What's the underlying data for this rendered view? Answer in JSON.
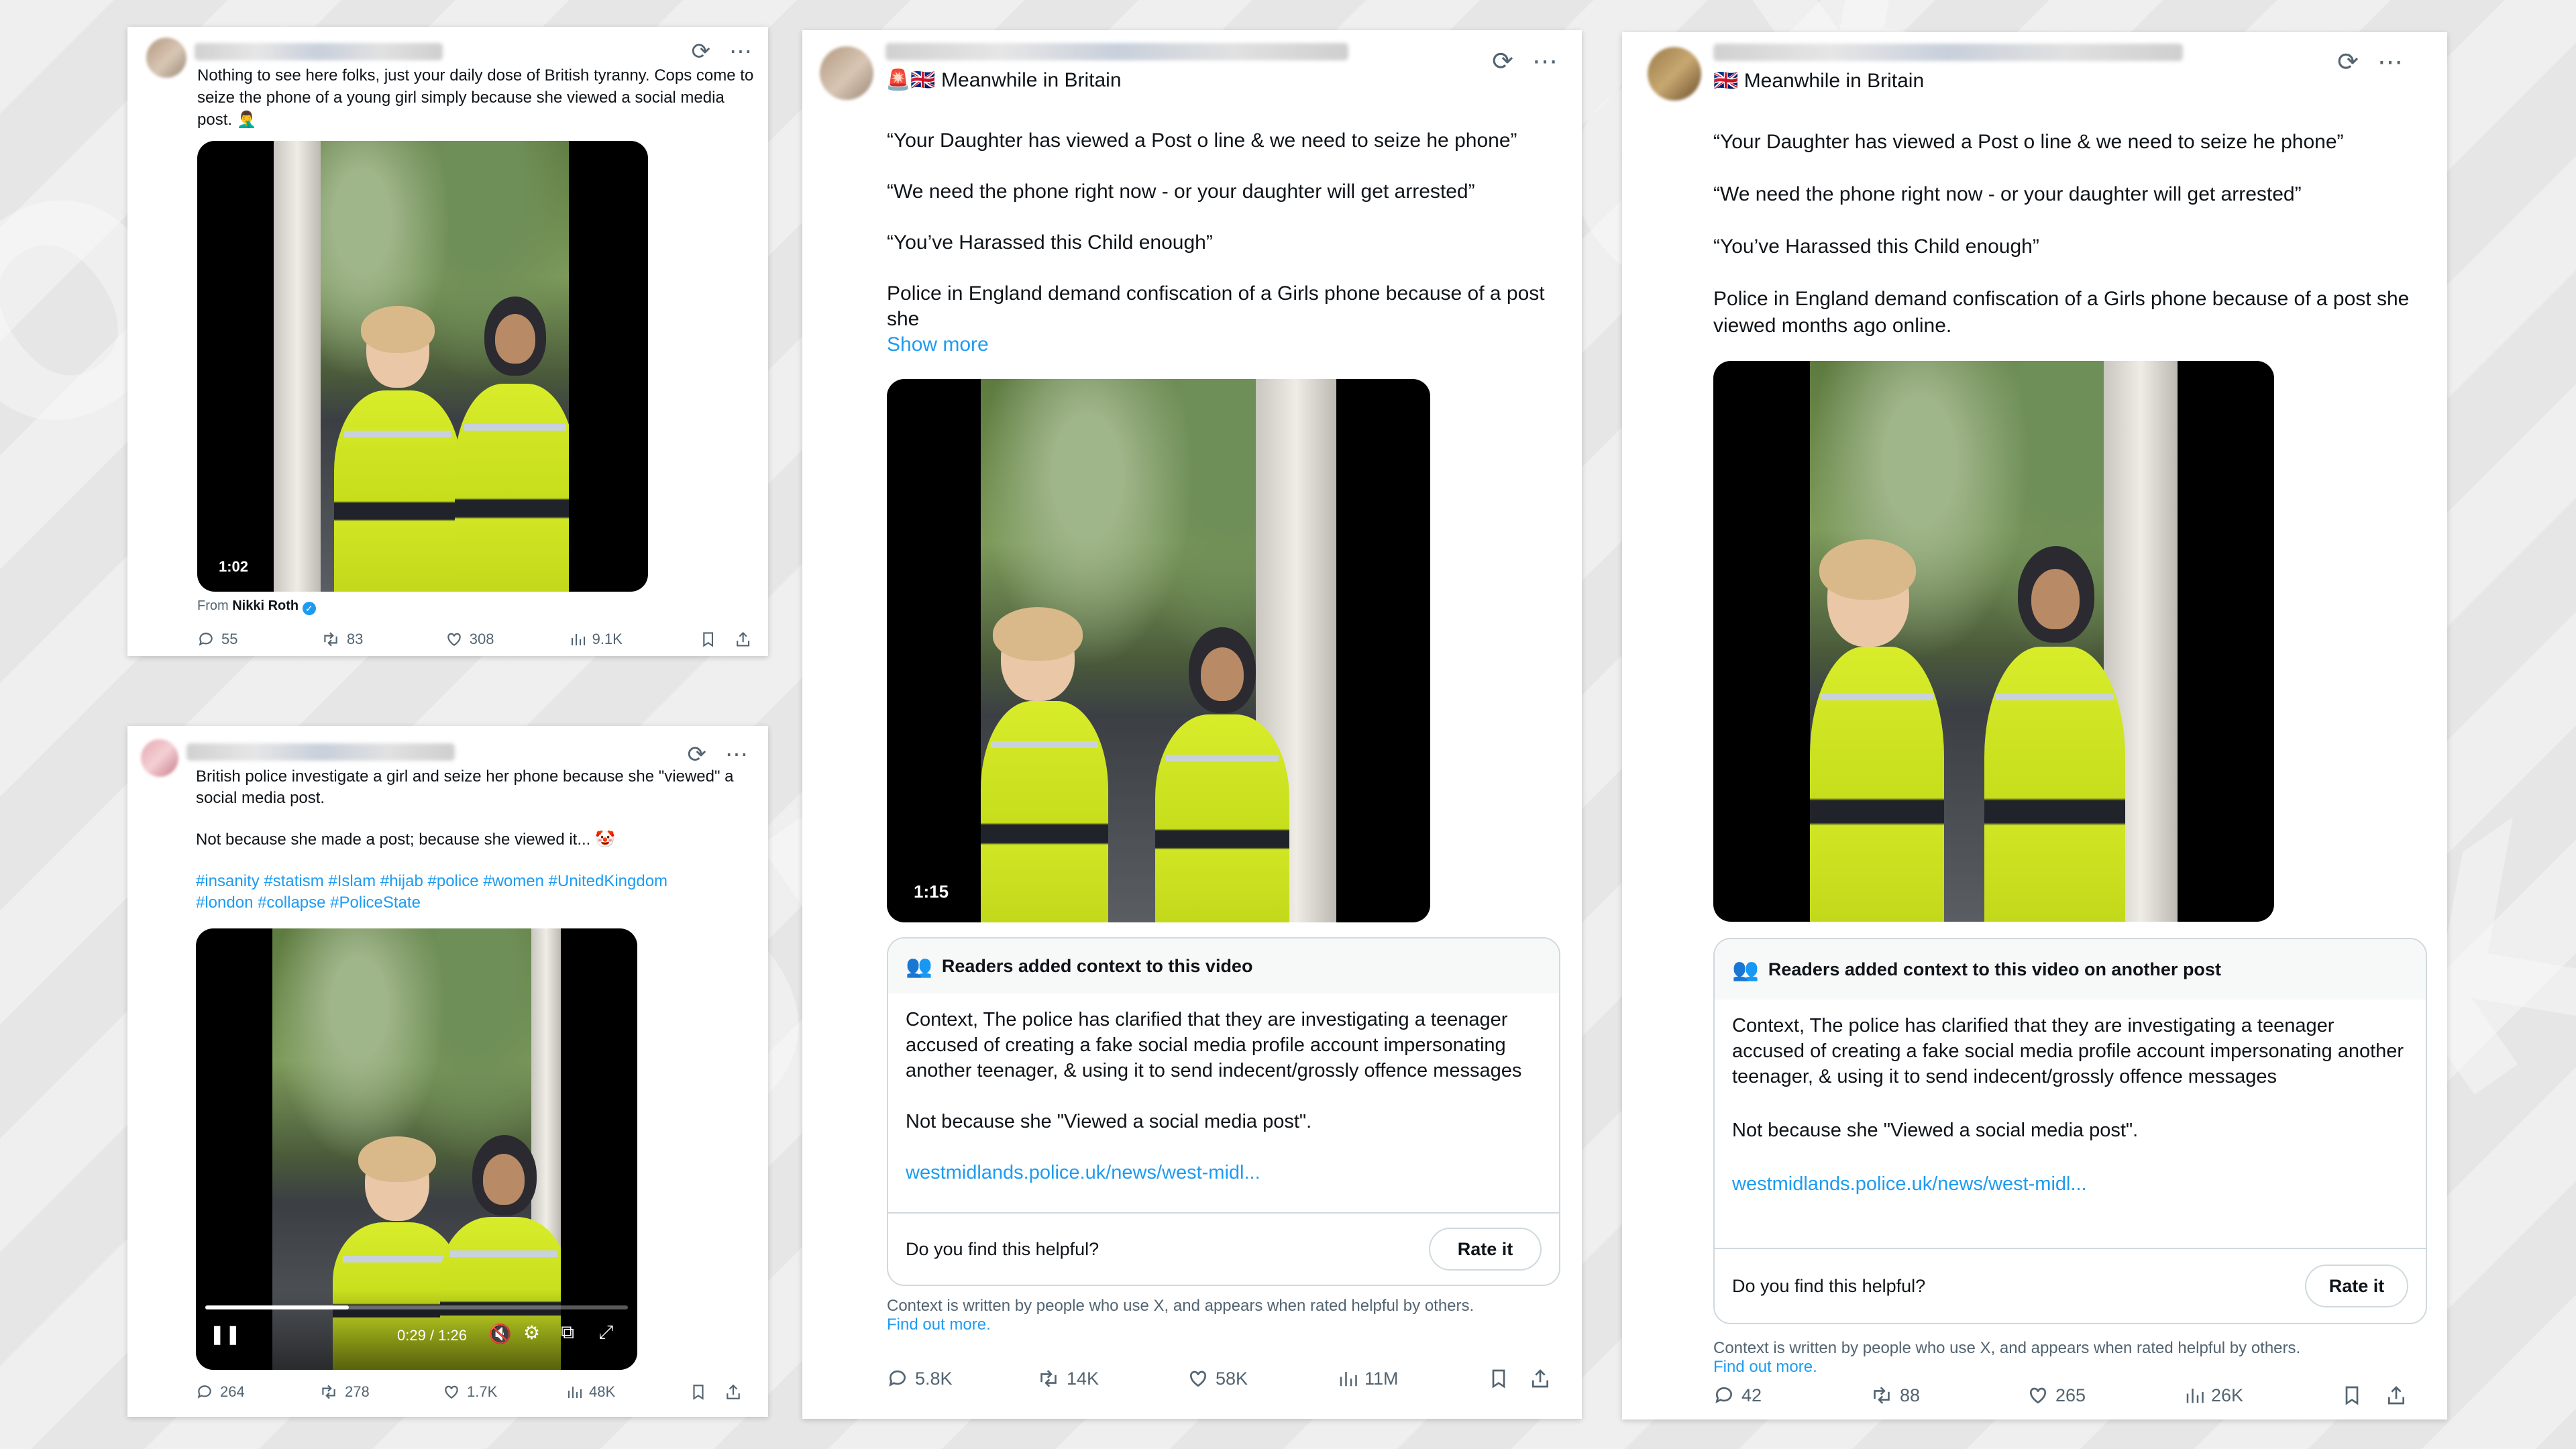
{
  "cards": {
    "top_left": {
      "text": "Nothing to see here folks, just your daily dose of British tyranny. Cops come to seize the phone of a young girl simply because she viewed a social media post. 🤦‍♂️",
      "video_duration": "1:02",
      "from_label": "From",
      "from_name": "Nikki Roth",
      "replies": "55",
      "reposts": "83",
      "likes": "308",
      "views": "9.1K"
    },
    "bottom_left": {
      "text": "British police investigate a girl and seize her phone because she \"viewed\" a social media post.",
      "text2": "Not because she made a post; because she viewed it... 🤡",
      "hashtags_line1": "#insanity #statism #Islam #hijab #police #women #UnitedKingdom",
      "hashtags_line2": "#london #collapse #PoliceState",
      "video_time": "0:29 / 1:26",
      "video_progress": 0.34,
      "replies": "264",
      "reposts": "278",
      "likes": "1.7K",
      "views": "48K"
    },
    "middle": {
      "account_name": "🚨🇬🇧 Meanwhile in Britain",
      "line1": "“Your Daughter has viewed a Post o line & we need to seize he phone”",
      "line2": "“We need the phone right now - or your daughter will get arrested”",
      "line3": "“You’ve Harassed this Child enough”",
      "line4": "Police in England demand confiscation of a Girls phone because of a post she",
      "show_more": "Show more",
      "video_duration": "1:15",
      "context_title": "Readers added context to this video",
      "context_body": "Context, The police has clarified that they are investigating a teenager accused of creating a fake social media profile account impersonating another teenager, & using it to send indecent/grossly offence messages",
      "context_body2": "Not because she \"Viewed a social media post\".",
      "context_link": "westmidlands.police.uk/news/west-midl...",
      "helpful_q": "Do you find this helpful?",
      "rate_label": "Rate it",
      "note_text": "Context is written by people who use X, and appears when rated helpful by others.",
      "find_out": "Find out more.",
      "replies": "5.8K",
      "reposts": "14K",
      "likes": "58K",
      "views": "11M"
    },
    "right": {
      "account_name": "🇬🇧 Meanwhile in Britain",
      "line1": "“Your Daughter has viewed a Post o line & we need to seize he phone”",
      "line2": "“We need the phone right now - or your daughter will get arrested”",
      "line3": "“You’ve Harassed this Child enough”",
      "line4": "Police in England demand confiscation of a Girls phone because of a post she viewed months ago online.",
      "context_title": "Readers added context to this video on another post",
      "context_body": "Context, The police has clarified that they are investigating a teenager accused of creating a fake social media profile account impersonating another teenager, & using it to send indecent/grossly offence messages",
      "context_body2": "Not because she \"Viewed a social media post\".",
      "context_link": "westmidlands.police.uk/news/west-midl...",
      "helpful_q": "Do you find this helpful?",
      "rate_label": "Rate it",
      "note_text": "Context is written by people who use X, and appears when rated helpful by others.",
      "find_out": "Find out more.",
      "replies": "42",
      "reposts": "88",
      "likes": "265",
      "views": "26K"
    }
  },
  "icons": {
    "grok": "grok-icon",
    "more": "more-icon",
    "reply": "reply-icon",
    "repost": "repost-icon",
    "like": "like-icon",
    "views": "views-icon",
    "bookmark": "bookmark-icon",
    "share": "share-icon"
  },
  "colors": {
    "link_blue": "#1d9bf0",
    "muted_gray": "#536471",
    "text_dark": "#0f1419",
    "background": "#e6e6e6"
  }
}
